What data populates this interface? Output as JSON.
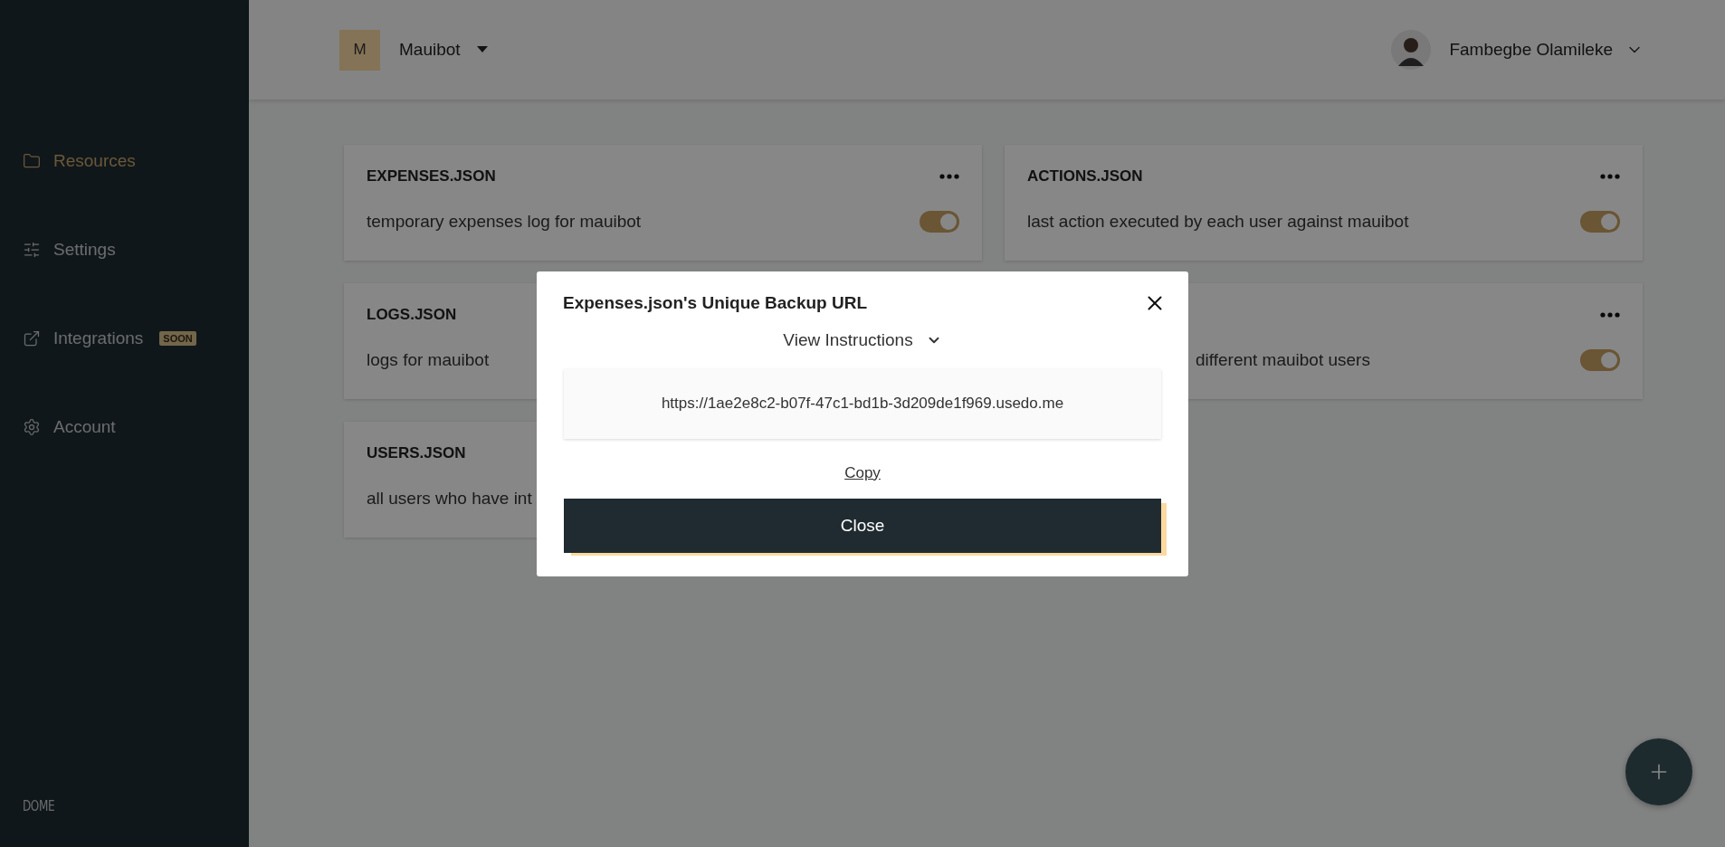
{
  "sidebar": {
    "items": [
      {
        "label": "Resources",
        "selected": true
      },
      {
        "label": "Settings",
        "selected": false
      },
      {
        "label": "Integrations",
        "selected": false,
        "badge": "SOON"
      },
      {
        "label": "Account",
        "selected": false
      }
    ],
    "brand": "DOME"
  },
  "header": {
    "project": {
      "initial": "M",
      "name": "Mauibot"
    },
    "user": {
      "name": "Fambegbe Olamileke"
    }
  },
  "cards": [
    {
      "kind": "full",
      "title": "EXPENSES.JSON",
      "description": "temporary expenses log for mauibot",
      "on": true
    },
    {
      "kind": "full",
      "title": "ACTIONS.JSON",
      "description": "last action executed by each user against mauibot",
      "on": true
    },
    {
      "kind": "covered_right",
      "title": "LOGS.JSON",
      "description": "logs for mauibot"
    },
    {
      "kind": "covered_left",
      "description": "different mauibot users",
      "on": true
    },
    {
      "kind": "covered_right",
      "title": "USERS.JSON",
      "description": "all users who have int"
    }
  ],
  "modal": {
    "title": "Expenses.json's Unique Backup URL",
    "instructions": "View Instructions",
    "url": "https://1ae2e8c2-b07f-47c1-bd1b-3d209de1f969.usedo.me",
    "copy": "Copy",
    "close": "Close"
  }
}
